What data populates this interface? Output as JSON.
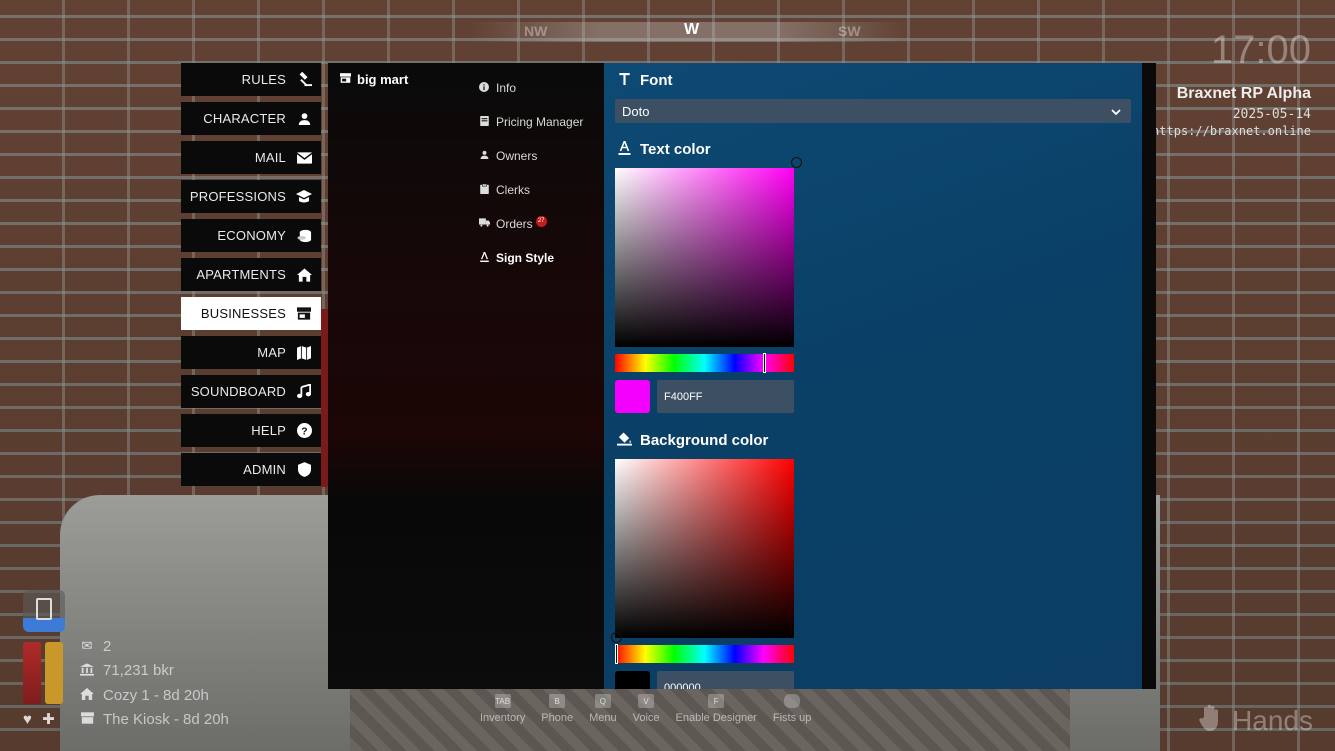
{
  "compass": {
    "left": "NW",
    "center": "W",
    "right": "SW"
  },
  "server": {
    "clock": "17:00",
    "name": "Braxnet RP Alpha",
    "date": "2025-05-14",
    "url": "https://braxnet.online"
  },
  "menu": {
    "items": [
      {
        "label": "RULES",
        "icon": "gavel-icon"
      },
      {
        "label": "CHARACTER",
        "icon": "person-icon"
      },
      {
        "label": "MAIL",
        "icon": "envelope-icon"
      },
      {
        "label": "PROFESSIONS",
        "icon": "graduation-cap-icon"
      },
      {
        "label": "ECONOMY",
        "icon": "coins-icon"
      },
      {
        "label": "APARTMENTS",
        "icon": "house-icon"
      },
      {
        "label": "BUSINESSES",
        "icon": "storefront-icon"
      },
      {
        "label": "MAP",
        "icon": "map-icon"
      },
      {
        "label": "SOUNDBOARD",
        "icon": "music-icon"
      },
      {
        "label": "HELP",
        "icon": "question-icon"
      },
      {
        "label": "ADMIN",
        "icon": "shield-icon"
      }
    ],
    "active": "BUSINESSES"
  },
  "business": {
    "name": "big mart",
    "submenu": [
      {
        "label": "Info",
        "icon": "info-icon"
      },
      {
        "label": "Pricing Manager",
        "icon": "receipt-icon"
      },
      {
        "label": "Owners",
        "icon": "person-icon"
      },
      {
        "label": "Clerks",
        "icon": "clipboard-icon"
      },
      {
        "label": "Orders",
        "icon": "truck-icon",
        "badge": "27"
      },
      {
        "label": "Sign Style",
        "icon": "text-color-icon"
      }
    ],
    "active": "Sign Style"
  },
  "sign_style": {
    "font_heading": "Font",
    "font_value": "Doto",
    "text_color_heading": "Text color",
    "text_color_hex": "F400FF",
    "text_color_value": "#F400FF",
    "text_hue": "#FF00F4",
    "text_hue_position": 0.83,
    "background_color_heading": "Background color",
    "background_color_hex": "000000",
    "background_color_value": "#000000",
    "background_hue": "#FF0000",
    "background_hue_position": 0.0
  },
  "hud": {
    "mail_count": "2",
    "money": "71,231 bkr",
    "apartment": "Cozy 1 - 8d 20h",
    "business": "The Kiosk - 8d 20h"
  },
  "keybinds": [
    {
      "key": "TAB",
      "label": "Inventory"
    },
    {
      "key": "B",
      "label": "Phone"
    },
    {
      "key": "Q",
      "label": "Menu"
    },
    {
      "key": "V",
      "label": "Voice"
    },
    {
      "key": "F",
      "label": "Enable Designer"
    },
    {
      "key": "",
      "label": "Fists up"
    }
  ],
  "hands_label": "Hands"
}
